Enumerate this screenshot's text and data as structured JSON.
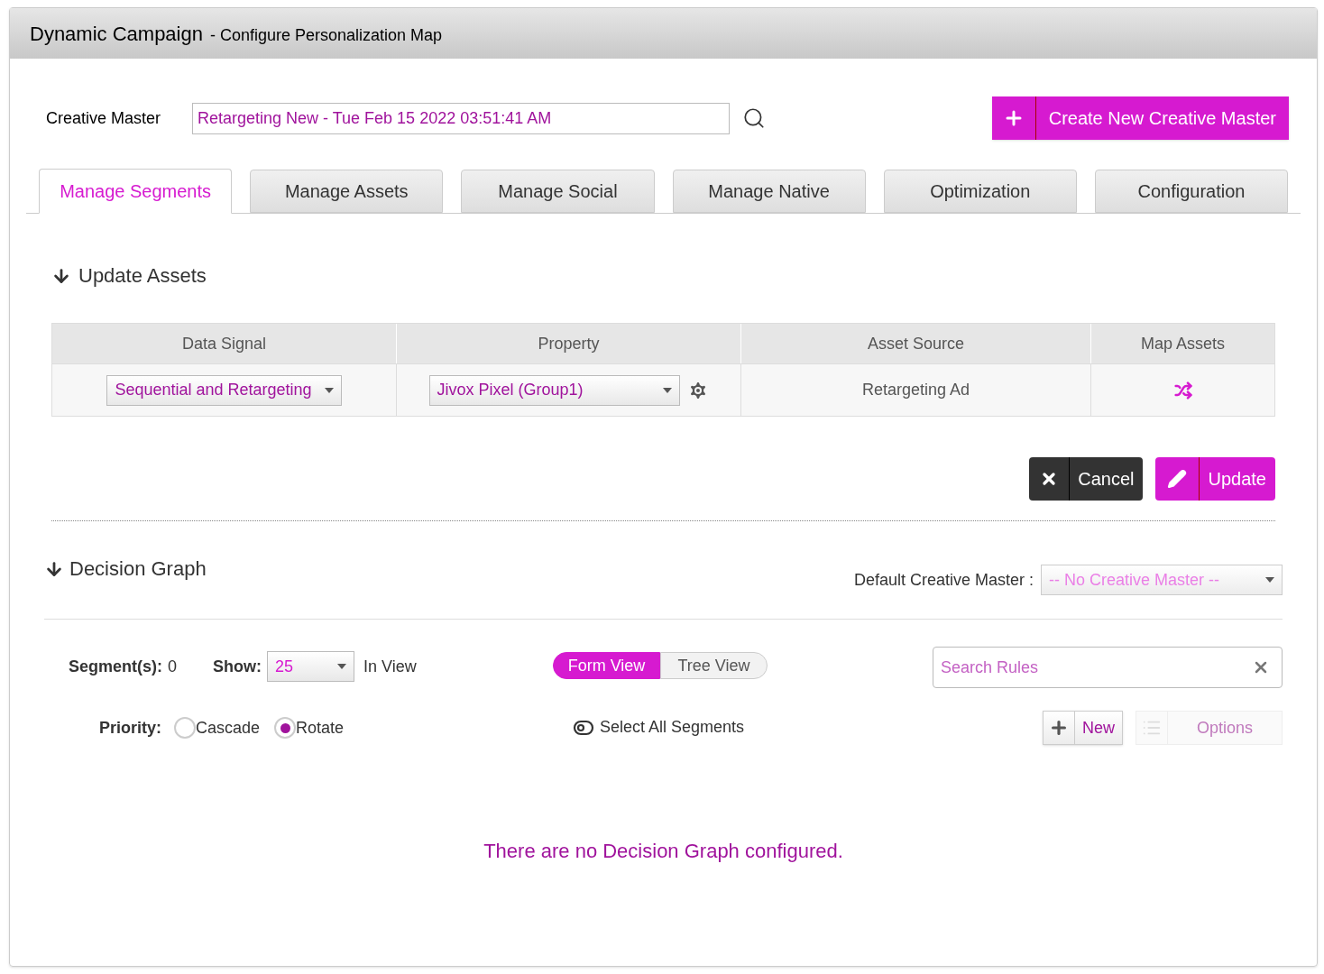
{
  "window": {
    "title": "Dynamic Campaign",
    "subtitle": "- Configure Personalization Map"
  },
  "creative_master": {
    "label": "Creative Master",
    "value": "Retargeting New - Tue Feb 15 2022 03:51:41 AM",
    "create_button": "Create New Creative Master"
  },
  "tabs": [
    {
      "label": "Manage Segments",
      "selected": true
    },
    {
      "label": "Manage Assets",
      "selected": false
    },
    {
      "label": "Manage Social",
      "selected": false
    },
    {
      "label": "Manage Native",
      "selected": false
    },
    {
      "label": "Optimization",
      "selected": false
    },
    {
      "label": "Configuration",
      "selected": false
    }
  ],
  "update_assets": {
    "heading": "Update Assets",
    "columns": [
      "Data Signal",
      "Property",
      "Asset Source",
      "Map Assets"
    ],
    "rows": [
      {
        "data_signal": "Sequential and Retargeting",
        "property": "Jivox Pixel (Group1)",
        "asset_source": "Retargeting Ad"
      }
    ],
    "cancel": "Cancel",
    "update": "Update"
  },
  "decision_graph": {
    "heading": "Decision Graph",
    "default_label": "Default Creative Master :",
    "default_value": "-- No Creative Master --",
    "segments_label": "Segment(s):",
    "segments_count": "0",
    "show_label": "Show:",
    "show_value": "25",
    "in_view": "In View",
    "views": [
      {
        "label": "Form View",
        "selected": true
      },
      {
        "label": "Tree View",
        "selected": false
      }
    ],
    "search": {
      "placeholder": "Search Rules"
    },
    "priority_label": "Priority:",
    "priority_options": [
      {
        "label": "Cascade",
        "selected": false
      },
      {
        "label": "Rotate",
        "selected": true
      }
    ],
    "select_all": "Select All Segments",
    "new_button": "New",
    "options_button": {
      "label": "Options",
      "disabled": true
    },
    "empty_message": "There are no Decision Graph configured."
  }
}
